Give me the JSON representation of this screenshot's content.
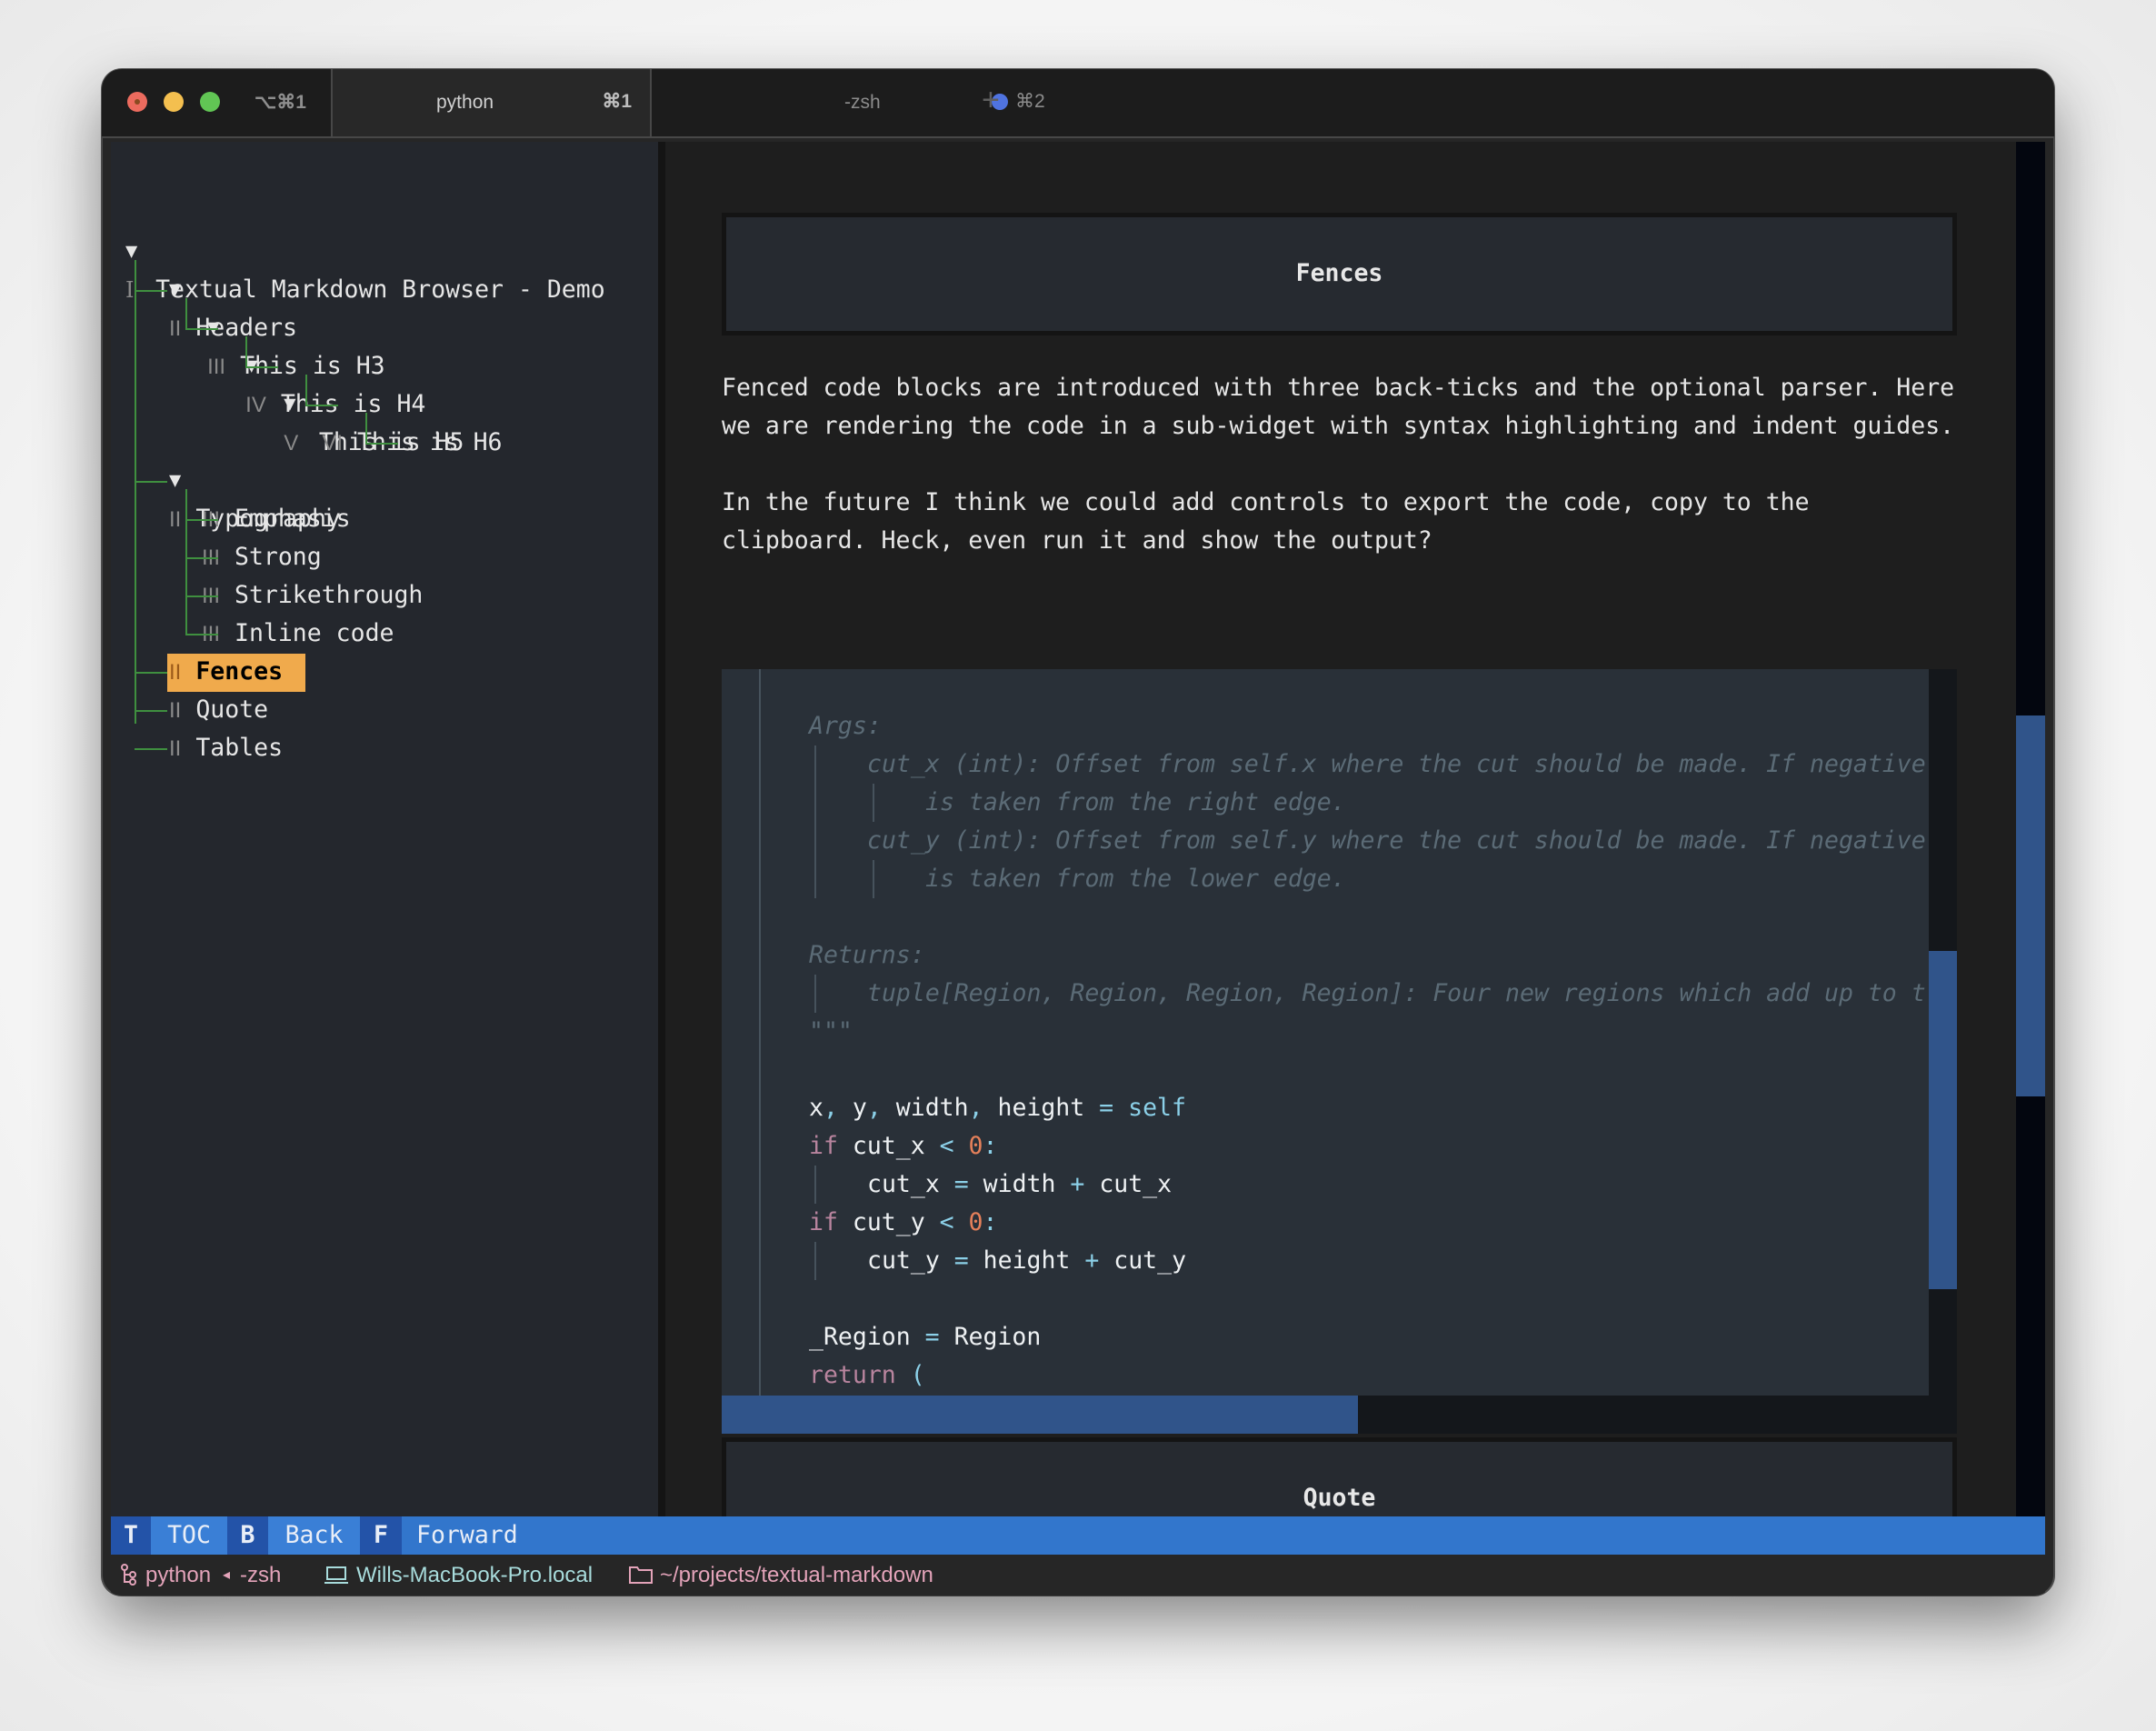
{
  "window": {
    "shortcut": "⌥⌘1",
    "tabs": [
      {
        "title": "python",
        "shortcut": "⌘1",
        "active": true
      },
      {
        "title": "-zsh",
        "shortcut": "⌘2",
        "active": false,
        "indicator_color": "#4f73e0"
      }
    ],
    "new_tab_label": "+"
  },
  "toc": {
    "items": [
      {
        "arrow": "▼",
        "level": "I",
        "label": "Textual Markdown Browser - Demo",
        "depth": 0
      },
      {
        "arrow": "▼",
        "level": "II",
        "label": "Headers",
        "depth": 1
      },
      {
        "arrow": "▼",
        "level": "III",
        "label": "This is H3",
        "depth": 2
      },
      {
        "arrow": "▼",
        "level": "IV",
        "label": "This is H4",
        "depth": 3
      },
      {
        "arrow": "▼",
        "level": "V",
        "label": "This is H5",
        "depth": 4
      },
      {
        "arrow": "",
        "level": "VI",
        "label": "This is H6",
        "depth": 5
      },
      {
        "arrow": "▼",
        "level": "II",
        "label": "Typography",
        "depth": 1
      },
      {
        "arrow": "",
        "level": "III",
        "label": "Emphasis",
        "depth": 2
      },
      {
        "arrow": "",
        "level": "III",
        "label": "Strong",
        "depth": 2
      },
      {
        "arrow": "",
        "level": "III",
        "label": "Strikethrough",
        "depth": 2
      },
      {
        "arrow": "",
        "level": "III",
        "label": "Inline code",
        "depth": 2
      },
      {
        "arrow": "",
        "level": "II",
        "label": "Fences",
        "depth": 1,
        "selected": true
      },
      {
        "arrow": "",
        "level": "II",
        "label": "Quote",
        "depth": 1
      },
      {
        "arrow": "",
        "level": "II",
        "label": "Tables",
        "depth": 1
      }
    ],
    "highlight_color": "#f0aa4c",
    "guide_color": "#3f8f3f"
  },
  "document": {
    "section_title": "Fences",
    "paragraphs": [
      [
        "Fenced code blocks are introduced with three back-ticks and the optional parser. Here",
        "we are rendering the code in a sub-widget with syntax highlighting and indent guides."
      ],
      [
        "In the future I think we could add controls to export the code, copy to the",
        "clipboard. Heck, even run it and show the output?"
      ]
    ],
    "code_lines": [
      {
        "indent": 0,
        "tokens": []
      },
      {
        "indent": 0,
        "tokens": [
          {
            "t": "Args:",
            "c": "cmt"
          }
        ]
      },
      {
        "indent": 1,
        "tokens": [
          {
            "t": "cut_x (int): Offset from self.x where the cut should be made. If negative",
            "c": "cmt"
          }
        ]
      },
      {
        "indent": 2,
        "tokens": [
          {
            "t": "is taken from the right edge.",
            "c": "cmt"
          }
        ]
      },
      {
        "indent": 1,
        "tokens": [
          {
            "t": "cut_y (int): Offset from self.y where the cut should be made. If negative",
            "c": "cmt"
          }
        ]
      },
      {
        "indent": 2,
        "tokens": [
          {
            "t": "is taken from the lower edge.",
            "c": "cmt"
          }
        ]
      },
      {
        "indent": 0,
        "tokens": []
      },
      {
        "indent": 0,
        "tokens": [
          {
            "t": "Returns:",
            "c": "cmt"
          }
        ]
      },
      {
        "indent": 1,
        "tokens": [
          {
            "t": "tuple[Region, Region, Region, Region]: Four new regions which add up to t",
            "c": "cmt"
          }
        ]
      },
      {
        "indent": 0,
        "tokens": [
          {
            "t": "\"\"\"",
            "c": "cmt"
          }
        ]
      },
      {
        "indent": 0,
        "tokens": []
      },
      {
        "indent": 0,
        "tokens": [
          {
            "t": "x",
            "c": ""
          },
          {
            "t": ",",
            "c": "op"
          },
          {
            "t": " y",
            "c": ""
          },
          {
            "t": ",",
            "c": "op"
          },
          {
            "t": " width",
            "c": ""
          },
          {
            "t": ",",
            "c": "op"
          },
          {
            "t": " height ",
            "c": ""
          },
          {
            "t": "=",
            "c": "op"
          },
          {
            "t": " ",
            "c": ""
          },
          {
            "t": "self",
            "c": "selfc"
          }
        ]
      },
      {
        "indent": 0,
        "tokens": [
          {
            "t": "if",
            "c": "kw"
          },
          {
            "t": " cut_x ",
            "c": ""
          },
          {
            "t": "<",
            "c": "op"
          },
          {
            "t": " ",
            "c": ""
          },
          {
            "t": "0",
            "c": "num"
          },
          {
            "t": ":",
            "c": "op"
          }
        ]
      },
      {
        "indent": 1,
        "tokens": [
          {
            "t": "cut_x ",
            "c": ""
          },
          {
            "t": "=",
            "c": "op"
          },
          {
            "t": " width ",
            "c": ""
          },
          {
            "t": "+",
            "c": "op"
          },
          {
            "t": " cut_x",
            "c": ""
          }
        ]
      },
      {
        "indent": 0,
        "tokens": [
          {
            "t": "if",
            "c": "kw"
          },
          {
            "t": " cut_y ",
            "c": ""
          },
          {
            "t": "<",
            "c": "op"
          },
          {
            "t": " ",
            "c": ""
          },
          {
            "t": "0",
            "c": "num"
          },
          {
            "t": ":",
            "c": "op"
          }
        ]
      },
      {
        "indent": 1,
        "tokens": [
          {
            "t": "cut_y ",
            "c": ""
          },
          {
            "t": "=",
            "c": "op"
          },
          {
            "t": " height ",
            "c": ""
          },
          {
            "t": "+",
            "c": "op"
          },
          {
            "t": " cut_y",
            "c": ""
          }
        ]
      },
      {
        "indent": 0,
        "tokens": []
      },
      {
        "indent": 0,
        "tokens": [
          {
            "t": "_Region ",
            "c": ""
          },
          {
            "t": "=",
            "c": "op"
          },
          {
            "t": " Region",
            "c": ""
          }
        ]
      },
      {
        "indent": 0,
        "tokens": [
          {
            "t": "return",
            "c": "kw"
          },
          {
            "t": " ",
            "c": ""
          },
          {
            "t": "(",
            "c": "op"
          }
        ]
      }
    ],
    "next_section_title": "Quote"
  },
  "footer": {
    "bindings": [
      {
        "key": "T",
        "label": "TOC"
      },
      {
        "key": "B",
        "label": "Back"
      },
      {
        "key": "F",
        "label": "Forward"
      }
    ]
  },
  "status_line": {
    "process_icon": "process-tree-icon",
    "process": "python",
    "separator": "◂",
    "parent_process": "-zsh",
    "host_icon": "laptop-icon",
    "host": "Wills-MacBook-Pro.local",
    "dir_icon": "folder-icon",
    "directory": "~/projects/textual-markdown"
  }
}
